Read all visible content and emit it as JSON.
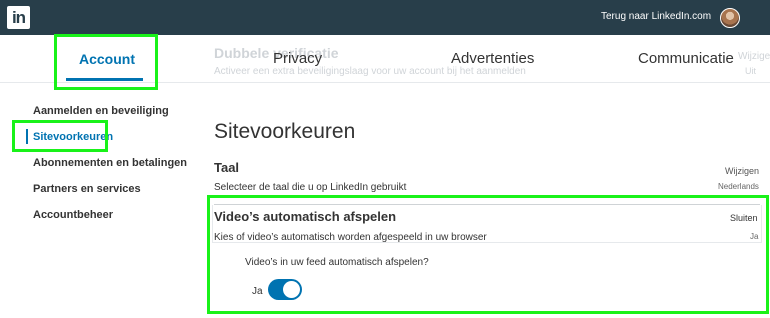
{
  "topbar": {
    "logo_text": "in",
    "back_link": "Terug naar LinkedIn.com"
  },
  "ghost": {
    "title": "Dubbele verificatie",
    "desc": "Activeer een extra beveiligingslaag voor uw account bij het aanmelden",
    "action": "Wijzigen",
    "value": "Uit"
  },
  "tabs": [
    {
      "label": "Account",
      "active": true
    },
    {
      "label": "Privacy",
      "active": false
    },
    {
      "label": "Advertenties",
      "active": false
    },
    {
      "label": "Communicatie",
      "active": false
    }
  ],
  "sidebar": {
    "items": [
      {
        "label": "Aanmelden en beveiliging",
        "active": false
      },
      {
        "label": "Sitevoorkeuren",
        "active": true
      },
      {
        "label": "Abonnementen en betalingen",
        "active": false
      },
      {
        "label": "Partners en services",
        "active": false
      },
      {
        "label": "Accountbeheer",
        "active": false
      }
    ]
  },
  "main": {
    "title": "Sitevoorkeuren",
    "language": {
      "title": "Taal",
      "description": "Selecteer de taal die u op LinkedIn gebruikt",
      "action": "Wijzigen",
      "value": "Nederlands"
    },
    "video": {
      "title": "Video’s automatisch afspelen",
      "description": "Kies of video’s automatisch worden afgespeeld in uw browser",
      "action": "Sluiten",
      "value": "Ja",
      "question": "Video’s in uw feed automatisch afspelen?",
      "toggle_label": "Ja",
      "toggle_on": true
    }
  },
  "colors": {
    "topbar": "#283e4a",
    "accent": "#0073b1",
    "highlight": "#19f219"
  }
}
